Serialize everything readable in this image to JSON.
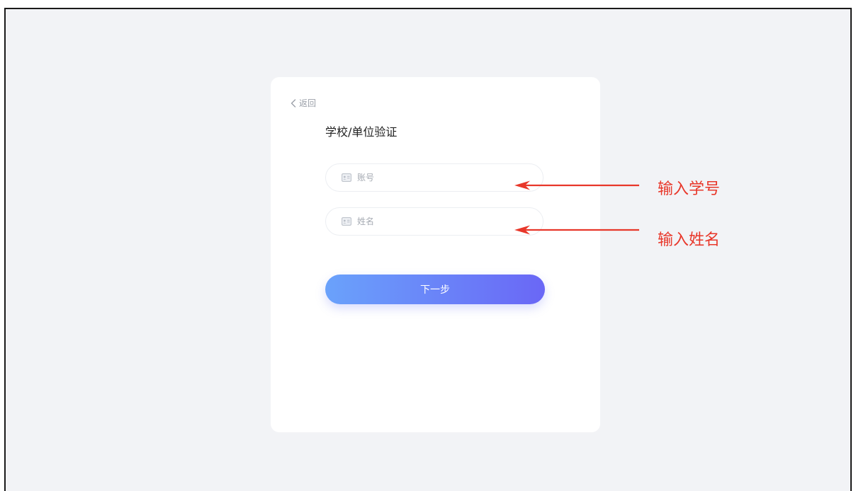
{
  "card": {
    "back_label": "返回",
    "title": "学校/单位验证",
    "account_placeholder": "账号",
    "name_placeholder": "姓名",
    "next_label": "下一步"
  },
  "annotations": {
    "account_note": "输入学号",
    "name_note": "输入姓名",
    "color": "#e8372a"
  },
  "theme": {
    "background": "#f2f3f6",
    "button_gradient": [
      "#6aa2fb",
      "#6a67f6"
    ]
  },
  "icons": {
    "back": "chevron-left-icon",
    "field": "id-card-icon",
    "annotation": "arrow-left-icon"
  }
}
